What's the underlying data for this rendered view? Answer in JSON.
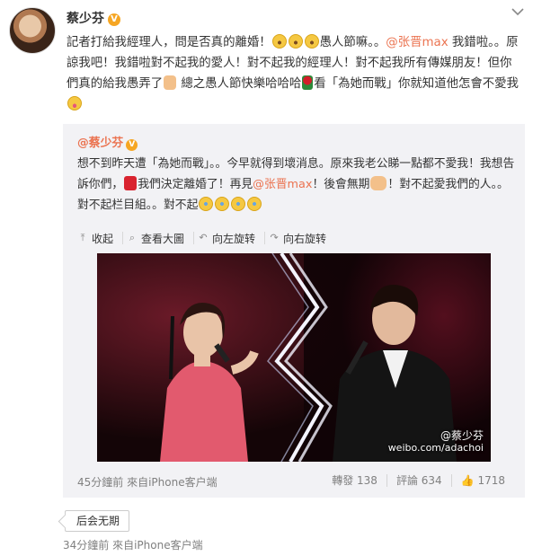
{
  "post": {
    "author": "蔡少芬",
    "verified_badge": "V",
    "text_1": "記者打給我經理人，問是否真的離婚！",
    "text_2": "愚人節嘛。。",
    "mention": "@张晋max",
    "text_3": " 我錯啦。。原諒我吧！我錯啦對不起我的愛人！對不起我的經理人！對不起我所有傳媒朋友！但你們真的給我愚弄了",
    "text_4": " 總之愚人節快樂哈哈哈",
    "text_5": "看「為她而戰」你就知道他怎會不愛我",
    "icons": {
      "menu": "chevron-down-icon",
      "shocked": "shocked-face-emoji",
      "peace": "peace-hand-emoji",
      "rose": "rose-emoji",
      "tongue": "tongue-face-emoji"
    }
  },
  "quoted": {
    "author": "@蔡少芬",
    "verified_badge": "V",
    "text_1": "想不到昨天遭「為她而戰」。。今早就得到壞消息。原來我老公睇一點都不愛我！我想告訴你們，",
    "text_2": "我們決定離婚了！再見",
    "mention": "@张晋max",
    "text_3": "！後會無期",
    "text_4": "！對不起愛我們的人。。對不起栏目組。。對不起",
    "tools": [
      {
        "icon": "collapse-icon",
        "label": "收起"
      },
      {
        "icon": "zoom-icon",
        "label": "查看大圖"
      },
      {
        "icon": "rotate-left-icon",
        "label": "向左旋转"
      },
      {
        "icon": "rotate-right-icon",
        "label": "向右旋转"
      }
    ],
    "watermark_name": "@蔡少芬",
    "watermark_url": "weibo.com/adachoi",
    "time": "45分鐘前 來自iPhone客户端",
    "reposts": "轉發 138",
    "comments": "評論 634",
    "likes": "1718",
    "icons": {
      "broken_heart": "broken-heart-emoji",
      "wave": "waving-hand-emoji",
      "cry": "crying-face-emoji",
      "like": "thumbs-up-icon"
    }
  },
  "comment_tag": "后会无期",
  "footer_time": "34分鐘前 來自iPhone客户端"
}
